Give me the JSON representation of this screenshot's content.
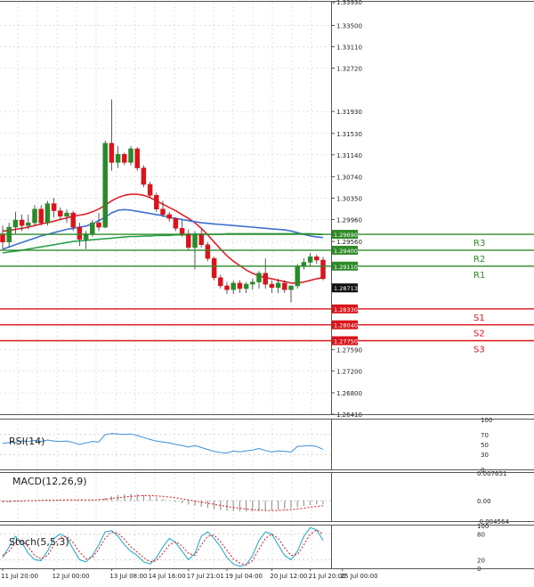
{
  "chart_data": [
    {
      "type": "candlestick",
      "panel": "price",
      "ylim": [
        1.2641,
        1.3393
      ],
      "y_ticks": [
        {
          "v": 1.3393,
          "label": "1.33930"
        },
        {
          "v": 1.335,
          "label": "1.33500"
        },
        {
          "v": 1.3311,
          "label": "1.33110"
        },
        {
          "v": 1.3272,
          "label": "1.32720"
        },
        {
          "v": 1.3193,
          "label": "1.31930"
        },
        {
          "v": 1.3153,
          "label": "1.31530"
        },
        {
          "v": 1.3114,
          "label": "1.31140"
        },
        {
          "v": 1.3074,
          "label": "1.30740"
        },
        {
          "v": 1.3035,
          "label": "1.30350"
        },
        {
          "v": 1.2996,
          "label": "1.29960"
        },
        {
          "v": 1.2956,
          "label": "1.29560"
        },
        {
          "v": 1.2759,
          "label": "1.27590"
        },
        {
          "v": 1.272,
          "label": "1.27200"
        },
        {
          "v": 1.268,
          "label": "1.26800"
        },
        {
          "v": 1.2641,
          "label": "1.26410"
        }
      ],
      "candles": [
        [
          1.297,
          1.2985,
          1.2942,
          1.2955
        ],
        [
          1.2955,
          1.299,
          1.2945,
          1.2982
        ],
        [
          1.2982,
          1.301,
          1.297,
          1.2995
        ],
        [
          1.2995,
          1.3005,
          1.2975,
          1.2985
        ],
        [
          1.2985,
          1.3005,
          1.2978,
          1.299
        ],
        [
          1.299,
          1.3022,
          1.2985,
          1.3015
        ],
        [
          1.3015,
          1.3022,
          1.2985,
          1.299
        ],
        [
          1.299,
          1.303,
          1.2985,
          1.3025
        ],
        [
          1.3025,
          1.3035,
          1.3,
          1.3012
        ],
        [
          1.3012,
          1.3018,
          1.2995,
          1.3002
        ],
        [
          1.3002,
          1.3015,
          1.299,
          1.3008
        ],
        [
          1.3008,
          1.3012,
          1.2975,
          1.2982
        ],
        [
          1.2982,
          1.299,
          1.2948,
          1.296
        ],
        [
          1.296,
          1.2975,
          1.2942,
          1.297
        ],
        [
          1.297,
          1.2995,
          1.2965,
          1.299
        ],
        [
          1.299,
          1.3008,
          1.2975,
          1.2982
        ],
        [
          1.2982,
          1.314,
          1.298,
          1.3135
        ],
        [
          1.3135,
          1.3215,
          1.3085,
          1.31
        ],
        [
          1.31,
          1.313,
          1.309,
          1.3115
        ],
        [
          1.3115,
          1.3118,
          1.3095,
          1.31
        ],
        [
          1.31,
          1.313,
          1.3095,
          1.3125
        ],
        [
          1.3125,
          1.3128,
          1.3085,
          1.309
        ],
        [
          1.309,
          1.3095,
          1.3055,
          1.306
        ],
        [
          1.306,
          1.3065,
          1.3035,
          1.304
        ],
        [
          1.304,
          1.3045,
          1.301,
          1.3015
        ],
        [
          1.3015,
          1.303,
          1.3,
          1.3005
        ],
        [
          1.3005,
          1.301,
          1.2992,
          1.2998
        ],
        [
          1.2998,
          1.3,
          1.2975,
          1.298
        ],
        [
          1.298,
          1.2995,
          1.2965,
          1.297
        ],
        [
          1.297,
          1.2978,
          1.294,
          1.2945
        ],
        [
          1.2945,
          1.2975,
          1.2905,
          1.297
        ],
        [
          1.297,
          1.2978,
          1.2945,
          1.295
        ],
        [
          1.295,
          1.2955,
          1.292,
          1.2925
        ],
        [
          1.2925,
          1.2928,
          1.2885,
          1.289
        ],
        [
          1.289,
          1.2895,
          1.287,
          1.2875
        ],
        [
          1.2875,
          1.2882,
          1.286,
          1.2868
        ],
        [
          1.2868,
          1.2885,
          1.286,
          1.288
        ],
        [
          1.288,
          1.2885,
          1.2862,
          1.287
        ],
        [
          1.287,
          1.2882,
          1.2862,
          1.2878
        ],
        [
          1.2878,
          1.2888,
          1.2868,
          1.2882
        ],
        [
          1.2882,
          1.2902,
          1.287,
          1.2898
        ],
        [
          1.2898,
          1.2925,
          1.287,
          1.2878
        ],
        [
          1.2878,
          1.2885,
          1.2862,
          1.2872
        ],
        [
          1.2872,
          1.2888,
          1.2862,
          1.288
        ],
        [
          1.288,
          1.2885,
          1.2862,
          1.2868
        ],
        [
          1.2868,
          1.2875,
          1.2845,
          1.2875
        ],
        [
          1.2875,
          1.2915,
          1.287,
          1.291
        ],
        [
          1.291,
          1.2925,
          1.2905,
          1.2918
        ],
        [
          1.2918,
          1.2935,
          1.291,
          1.2928
        ],
        [
          1.2928,
          1.2932,
          1.2915,
          1.2922
        ],
        [
          1.2922,
          1.2928,
          1.2885,
          1.2888
        ]
      ],
      "overlays": [
        {
          "color": "#e0202a",
          "values": [
            1.2975,
            1.2976,
            1.2978,
            1.298,
            1.2982,
            1.2985,
            1.2988,
            1.299,
            1.2993,
            1.2996,
            1.2999,
            1.3002,
            1.3004,
            1.3006,
            1.301,
            1.3015,
            1.3022,
            1.303,
            1.3036,
            1.304,
            1.3042,
            1.3042,
            1.304,
            1.3036,
            1.303,
            1.3024,
            1.3018,
            1.3012,
            1.3005,
            1.2998,
            1.299,
            1.298,
            1.2968,
            1.2955,
            1.2942,
            1.293,
            1.292,
            1.2912,
            1.2904,
            1.2898,
            1.2893,
            1.289,
            1.2888,
            1.2885,
            1.2883,
            1.288,
            1.288,
            1.2882,
            1.2885,
            1.2888,
            1.289
          ]
        },
        {
          "color": "#3f6fd0",
          "values": [
            1.2942,
            1.2946,
            1.295,
            1.2954,
            1.2958,
            1.2962,
            1.2966,
            1.2969,
            1.2972,
            1.2975,
            1.2978,
            1.298,
            1.2982,
            1.2984,
            1.2988,
            1.2994,
            1.3,
            1.3008,
            1.3013,
            1.3014,
            1.3013,
            1.3011,
            1.3009,
            1.3007,
            1.3005,
            1.3003,
            1.3,
            1.2998,
            1.2996,
            1.2994,
            1.2992,
            1.299,
            1.2989,
            1.2988,
            1.2987,
            1.2986,
            1.2985,
            1.2984,
            1.2983,
            1.2982,
            1.2981,
            1.298,
            1.2979,
            1.2978,
            1.2977,
            1.2975,
            1.2972,
            1.2969,
            1.2966,
            1.2964,
            1.2963
          ]
        },
        {
          "color": "#2aa04a",
          "values": [
            1.2935,
            1.2937,
            1.2938,
            1.294,
            1.2942,
            1.2944,
            1.2946,
            1.2948,
            1.295,
            1.2952,
            1.2954,
            1.2956,
            1.2957,
            1.2958,
            1.2959,
            1.296,
            1.2961,
            1.2962,
            1.2963,
            1.2964,
            1.2965,
            1.2965,
            1.2966,
            1.2966,
            1.2967,
            1.2967,
            1.2967,
            1.2968,
            1.2968,
            1.2968,
            1.2969,
            1.2969,
            1.2969,
            1.2969,
            1.2969,
            1.297,
            1.297,
            1.297,
            1.297,
            1.297,
            1.297,
            1.297,
            1.297,
            1.297,
            1.297,
            1.297,
            1.297,
            1.297,
            1.297,
            1.2969,
            1.2969
          ]
        }
      ],
      "levels": [
        {
          "name": "R3",
          "value": 1.2969,
          "value_label": "1.29690",
          "color": "#2d8a28"
        },
        {
          "name": "R2",
          "value": 1.294,
          "value_label": "1.29400",
          "color": "#2d8a28"
        },
        {
          "name": "R1",
          "value": 1.2911,
          "value_label": "1.29110",
          "color": "#2d8a28"
        },
        {
          "name": "S1",
          "value": 1.2833,
          "value_label": "1.28330",
          "color": "#d9141c"
        },
        {
          "name": "S2",
          "value": 1.2804,
          "value_label": "1.28040",
          "color": "#d9141c"
        },
        {
          "name": "S3",
          "value": 1.2775,
          "value_label": "1.27750",
          "color": "#d9141c"
        }
      ],
      "current_price": {
        "value": 1.28713,
        "label": "1.28713"
      }
    },
    {
      "type": "line",
      "panel": "rsi",
      "title": "RSI(14)",
      "ylim": [
        0,
        100
      ],
      "y_ticks": [
        {
          "v": 100,
          "label": "100"
        },
        {
          "v": 70,
          "label": "70"
        },
        {
          "v": 50,
          "label": "50"
        },
        {
          "v": 30,
          "label": "30"
        },
        {
          "v": 0,
          "label": "0"
        }
      ],
      "series": [
        {
          "color": "#3d8fd8",
          "values": [
            52,
            54,
            55,
            57,
            56,
            58,
            56,
            59,
            57,
            56,
            57,
            54,
            50,
            53,
            56,
            55,
            70,
            72,
            71,
            70,
            71,
            68,
            64,
            60,
            57,
            55,
            53,
            50,
            48,
            45,
            48,
            44,
            40,
            36,
            34,
            33,
            37,
            35,
            37,
            39,
            42,
            38,
            35,
            37,
            36,
            35,
            46,
            47,
            48,
            46,
            40
          ]
        }
      ]
    },
    {
      "type": "line",
      "panel": "macd",
      "title": "MACD(12,26,9)",
      "ylim": [
        -0.00564,
        0.00765
      ],
      "y_ticks": [
        {
          "v": 0.00765,
          "label": "0.007651"
        },
        {
          "v": 0,
          "label": "0.00"
        },
        {
          "v": -0.00564,
          "label": "-0.004564"
        }
      ],
      "histogram": [
        -0.0005,
        -0.0004,
        -0.0003,
        -0.0002,
        -0.0001,
        0.0,
        0.0001,
        0.0002,
        0.0002,
        0.0002,
        0.0002,
        0.0001,
        0.0,
        0.0,
        0.0001,
        0.0002,
        0.0008,
        0.0013,
        0.0016,
        0.0018,
        0.0019,
        0.0018,
        0.0016,
        0.0013,
        0.0009,
        0.0005,
        0.0001,
        -0.0003,
        -0.0007,
        -0.0011,
        -0.0014,
        -0.0017,
        -0.002,
        -0.0023,
        -0.0026,
        -0.0028,
        -0.0029,
        -0.003,
        -0.003,
        -0.003,
        -0.0029,
        -0.0028,
        -0.0027,
        -0.0025,
        -0.0023,
        -0.0021,
        -0.0018,
        -0.0015,
        -0.0012,
        -0.001,
        -0.001
      ],
      "signal": [
        -0.0002,
        -0.0002,
        -0.0001,
        -0.0001,
        0.0,
        0.0,
        0.0001,
        0.0001,
        0.0001,
        0.0002,
        0.0002,
        0.0002,
        0.0002,
        0.0002,
        0.0002,
        0.0003,
        0.0004,
        0.0006,
        0.0008,
        0.001,
        0.0012,
        0.0013,
        0.0014,
        0.0014,
        0.0013,
        0.0012,
        0.001,
        0.0008,
        0.0005,
        0.0002,
        -0.0001,
        -0.0004,
        -0.0007,
        -0.001,
        -0.0013,
        -0.0016,
        -0.0019,
        -0.0021,
        -0.0023,
        -0.0025,
        -0.0026,
        -0.0027,
        -0.0027,
        -0.0027,
        -0.0026,
        -0.0025,
        -0.0023,
        -0.0021,
        -0.0018,
        -0.0016,
        -0.0014
      ]
    },
    {
      "type": "line",
      "panel": "stoch",
      "title": "Stoch(5,5,3)",
      "ylim": [
        0,
        100
      ],
      "y_ticks": [
        {
          "v": 100,
          "label": "100"
        },
        {
          "v": 80,
          "label": "80"
        },
        {
          "v": 20,
          "label": "20"
        },
        {
          "v": 0,
          "label": "0"
        }
      ],
      "main": [
        25,
        50,
        75,
        60,
        35,
        20,
        18,
        40,
        70,
        80,
        72,
        45,
        20,
        15,
        30,
        55,
        85,
        88,
        75,
        55,
        40,
        30,
        15,
        10,
        25,
        50,
        70,
        60,
        40,
        20,
        35,
        75,
        85,
        70,
        50,
        25,
        10,
        5,
        8,
        30,
        65,
        85,
        80,
        55,
        30,
        20,
        40,
        75,
        95,
        90,
        65
      ],
      "signal": [
        30,
        40,
        60,
        65,
        50,
        30,
        22,
        30,
        55,
        72,
        75,
        60,
        38,
        22,
        25,
        45,
        70,
        85,
        82,
        68,
        50,
        38,
        25,
        15,
        18,
        35,
        55,
        62,
        52,
        35,
        30,
        55,
        75,
        78,
        62,
        42,
        22,
        12,
        8,
        18,
        45,
        70,
        80,
        70,
        48,
        30,
        32,
        55,
        80,
        90,
        80
      ]
    }
  ],
  "x_labels": [
    {
      "index": 0,
      "label": "11 Jul 20:00"
    },
    {
      "index": 8,
      "label": "12 Jul 00:00"
    },
    {
      "index": 17,
      "label": "13 Jul 08:00"
    },
    {
      "index": 23,
      "label": "14 Jul 16:00"
    },
    {
      "index": 29,
      "label": "17 Jul 21:01"
    },
    {
      "index": 35,
      "label": "19 Jul 04:00"
    },
    {
      "index": 42,
      "label": "20 Jul 12:00"
    },
    {
      "index": 48,
      "label": "21 Jul 20:00"
    },
    {
      "index": 53,
      "label": "25 Jul 00:00"
    }
  ]
}
